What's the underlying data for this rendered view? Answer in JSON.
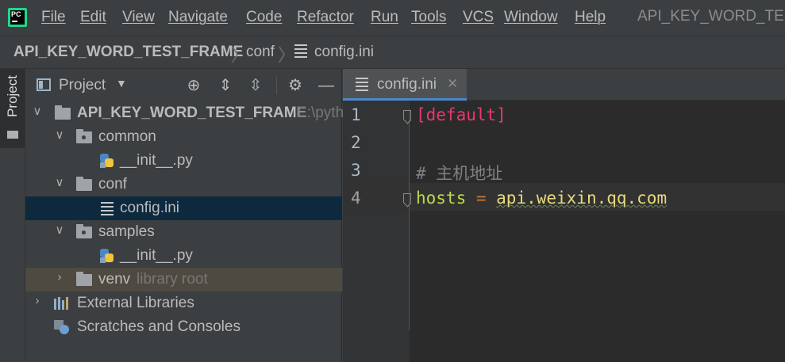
{
  "app": {
    "logo_text": "PC"
  },
  "menu": {
    "items": [
      "File",
      "Edit",
      "View",
      "Navigate",
      "Code",
      "Refactor",
      "Run",
      "Tools",
      "VCS",
      "Window",
      "Help"
    ],
    "window_title": "API_KEY_WORD_TEST_"
  },
  "breadcrumb": {
    "root": "API_KEY_WORD_TEST_FRAME",
    "folder": "conf",
    "file": "config.ini"
  },
  "toolstrip": {
    "project_tab": "Project"
  },
  "project_panel": {
    "title": "Project",
    "root": {
      "name": "API_KEY_WORD_TEST_FRAME",
      "path": "E:\\pyth"
    },
    "common": "common",
    "common_init": "__init__.py",
    "conf": "conf",
    "config_file": "config.ini",
    "samples": "samples",
    "samples_init": "__init__.py",
    "venv": "venv",
    "venv_note": "library root",
    "external_libraries": "External Libraries",
    "scratches": "Scratches and Consoles"
  },
  "editor": {
    "tab_label": "config.ini",
    "lines": [
      {
        "number": "1",
        "text": "[default]",
        "color": "#e8386c"
      },
      {
        "number": "2",
        "text": "",
        "color": "#a9b7c6"
      },
      {
        "number": "3",
        "text": "# 主机地址",
        "color": "#808080"
      },
      {
        "number": "4",
        "key": "hosts",
        "eq": " = ",
        "value": "api.weixin.qq.com"
      }
    ],
    "colors": {
      "key": "#bcd94c",
      "eq": "#cc7832",
      "value": "#e6d97e",
      "section": "#e8386c",
      "comment": "#808080"
    }
  }
}
